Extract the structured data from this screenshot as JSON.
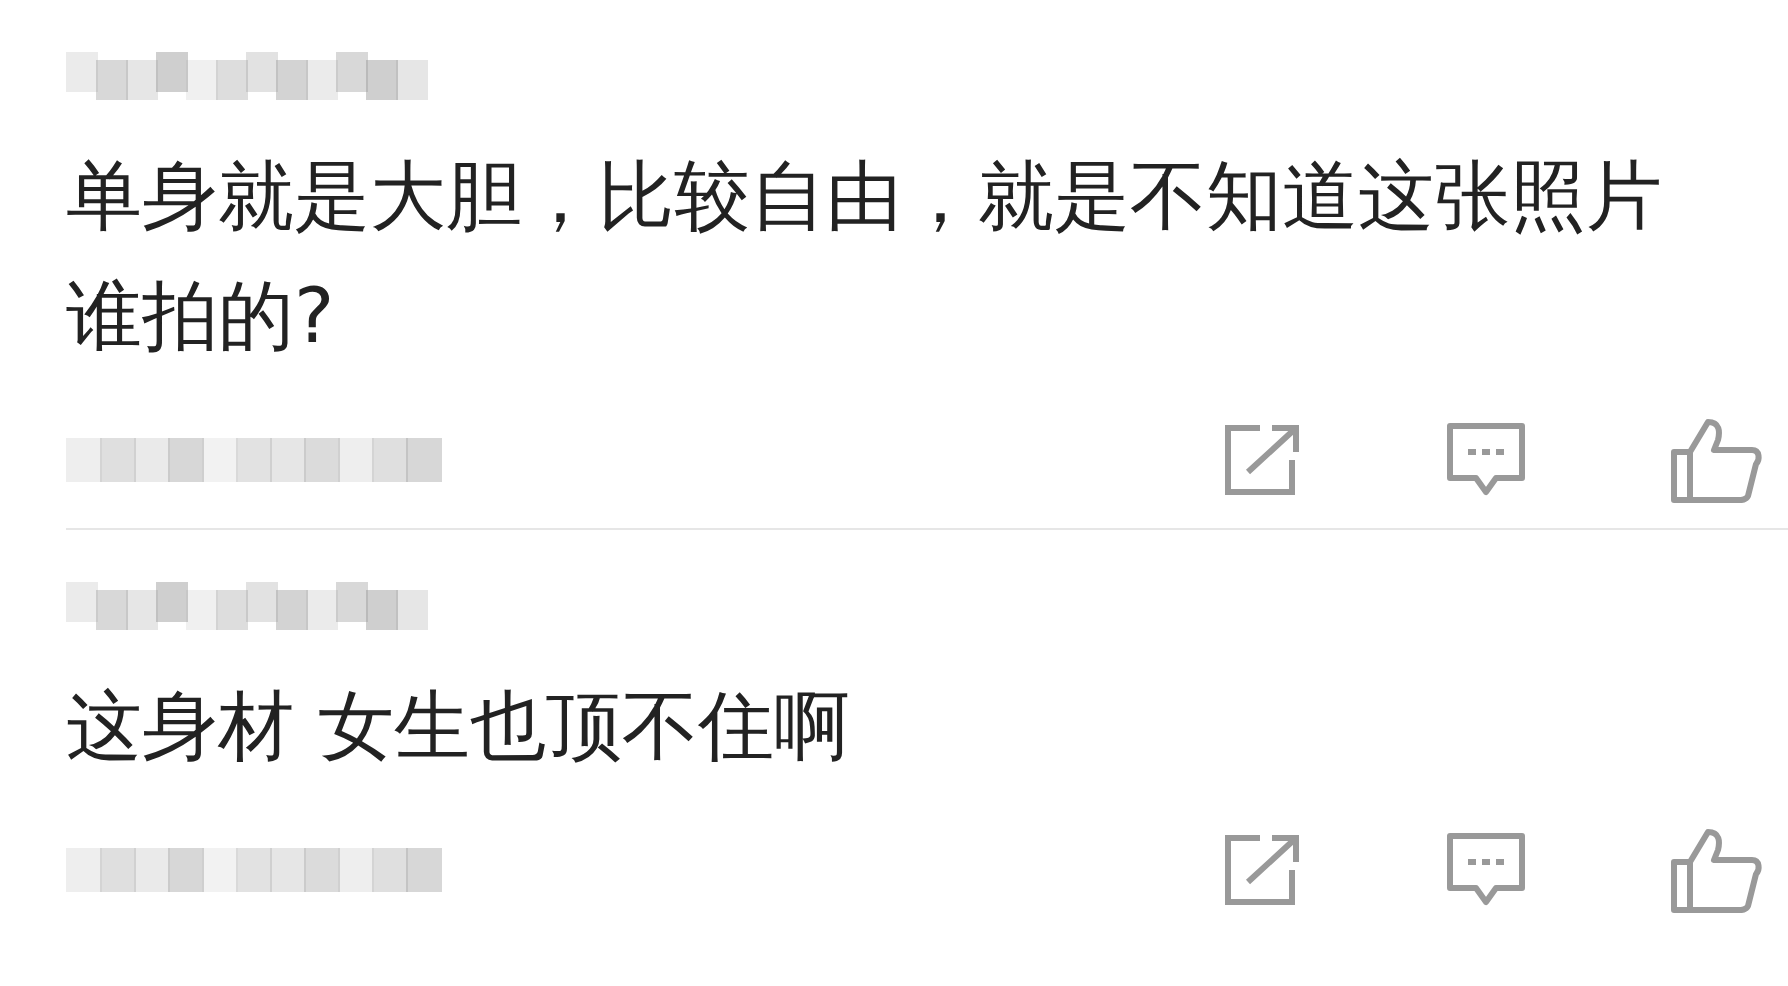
{
  "comments": [
    {
      "text": "单身就是大胆，比较自由，就是不知道这张照片谁拍的?"
    },
    {
      "text": "这身材  女生也顶不住啊"
    }
  ]
}
